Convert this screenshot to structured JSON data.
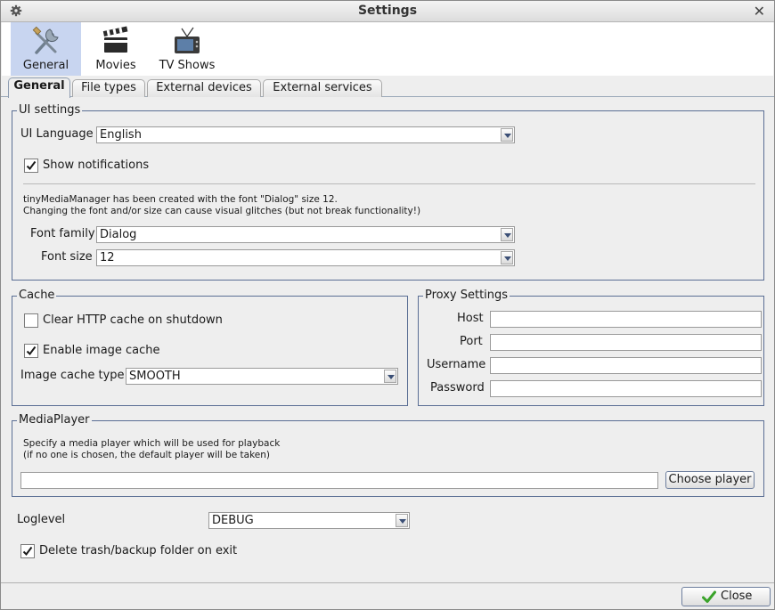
{
  "window": {
    "title": "Settings"
  },
  "icon_tabs": [
    {
      "label": "General",
      "icon": "tools-icon"
    },
    {
      "label": "Movies",
      "icon": "clapperboard-icon"
    },
    {
      "label": "TV Shows",
      "icon": "tv-icon"
    }
  ],
  "sub_tabs": [
    "General",
    "File types",
    "External devices",
    "External services"
  ],
  "ui_settings": {
    "title": "UI settings",
    "language_label": "UI Language",
    "language_value": "English",
    "show_notifications_label": "Show notifications",
    "show_notifications_checked": true,
    "font_note_line1": "tinyMediaManager has been created with the font \"Dialog\" size 12.",
    "font_note_line2": "Changing the font and/or size can cause visual glitches (but not break functionality!)",
    "font_family_label": "Font family",
    "font_family_value": "Dialog",
    "font_size_label": "Font size",
    "font_size_value": "12"
  },
  "cache": {
    "title": "Cache",
    "clear_http_label": "Clear HTTP cache on shutdown",
    "clear_http_checked": false,
    "enable_image_label": "Enable image cache",
    "enable_image_checked": true,
    "image_cache_type_label": "Image cache type",
    "image_cache_type_value": "SMOOTH"
  },
  "proxy": {
    "title": "Proxy Settings",
    "host_label": "Host",
    "port_label": "Port",
    "username_label": "Username",
    "password_label": "Password",
    "host_value": "",
    "port_value": "",
    "username_value": "",
    "password_value": ""
  },
  "media_player": {
    "title": "MediaPlayer",
    "note_line1": "Specify a media player which will be used for playback",
    "note_line2": "(if no one is chosen, the default player will be taken)",
    "path_value": "",
    "choose_label": "Choose player"
  },
  "loglevel": {
    "label": "Loglevel",
    "value": "DEBUG"
  },
  "delete_trash": {
    "label": "Delete trash/backup folder on exit",
    "checked": true
  },
  "footer": {
    "close_label": "Close"
  },
  "colors": {
    "selected_tab": "#c8d5f0",
    "group_border": "#5a6e94",
    "check_mark": "#1a1a1a",
    "close_check": "#3aa32a"
  }
}
